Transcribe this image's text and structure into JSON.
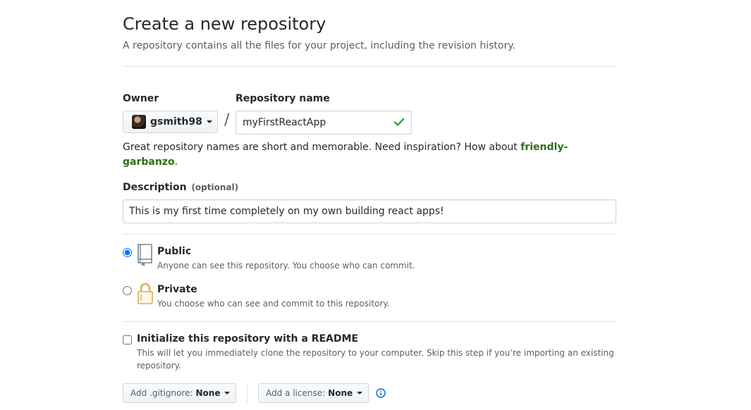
{
  "header": {
    "title": "Create a new repository",
    "subtitle": "A repository contains all the files for your project, including the revision history."
  },
  "owner": {
    "label": "Owner",
    "username": "gsmith98",
    "avatar_icon": "user-avatar"
  },
  "separator": "/",
  "repository": {
    "label": "Repository name",
    "value": "myFirstReactApp",
    "valid_icon": "check-icon",
    "valid_color": "#28a745"
  },
  "hint": {
    "text": "Great repository names are short and memorable. Need inspiration? How about ",
    "suggestion": "friendly-garbanzo",
    "suffix": "."
  },
  "description": {
    "label": "Description",
    "optional": "(optional)",
    "value": "This is my first time completely on my own building react apps!"
  },
  "visibility": {
    "selected": "public",
    "options": [
      {
        "id": "public",
        "title": "Public",
        "note": "Anyone can see this repository. You choose who can commit.",
        "icon": "repo-book-icon"
      },
      {
        "id": "private",
        "title": "Private",
        "note": "You choose who can see and commit to this repository.",
        "icon": "lock-icon"
      }
    ]
  },
  "readme": {
    "checked": false,
    "title": "Initialize this repository with a README",
    "note": "This will let you immediately clone the repository to your computer. Skip this step if you’re importing an existing repository."
  },
  "gitignore": {
    "prefix": "Add .gitignore:",
    "value": "None"
  },
  "license": {
    "prefix": "Add a license:",
    "value": "None",
    "info_icon": "info-icon"
  },
  "colors": {
    "suggestion": "#2c6e15",
    "muted": "#586069",
    "border": "#d1d5da",
    "info": "#0366d6"
  }
}
